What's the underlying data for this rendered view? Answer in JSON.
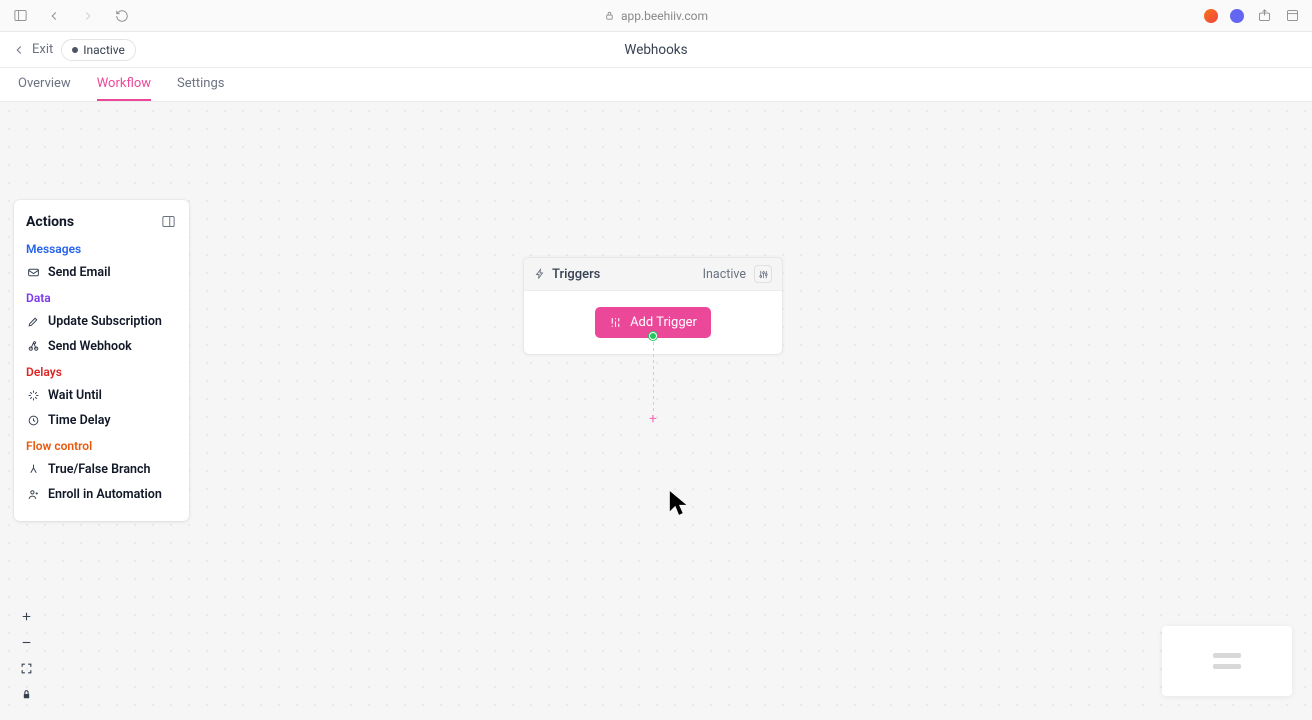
{
  "browser": {
    "url": "app.beehiiv.com"
  },
  "header": {
    "exit_label": "Exit",
    "status_label": "Inactive",
    "page_title": "Webhooks"
  },
  "tabs": [
    {
      "label": "Overview",
      "active": false
    },
    {
      "label": "Workflow",
      "active": true
    },
    {
      "label": "Settings",
      "active": false
    }
  ],
  "actions_panel": {
    "title": "Actions",
    "sections": {
      "messages": {
        "label": "Messages",
        "items": [
          "Send Email"
        ]
      },
      "data": {
        "label": "Data",
        "items": [
          "Update Subscription",
          "Send Webhook"
        ]
      },
      "delays": {
        "label": "Delays",
        "items": [
          "Wait Until",
          "Time Delay"
        ]
      },
      "flow": {
        "label": "Flow control",
        "items": [
          "True/False Branch",
          "Enroll in Automation"
        ]
      }
    }
  },
  "trigger_card": {
    "title": "Triggers",
    "status": "Inactive",
    "add_button": "Add Trigger"
  }
}
